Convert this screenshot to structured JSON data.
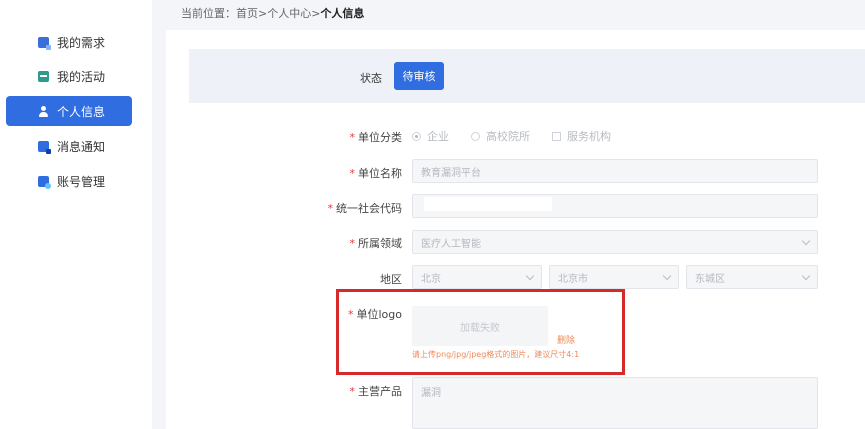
{
  "breadcrumb": {
    "prefix": "当前位置：首页>个人中心>",
    "current": "个人信息"
  },
  "sidebar": {
    "items": [
      {
        "label": "我的需求",
        "icon": "document-icon",
        "active": false
      },
      {
        "label": "我的活动",
        "icon": "calendar-icon",
        "active": false
      },
      {
        "label": "个人信息",
        "icon": "user-icon",
        "active": true
      },
      {
        "label": "消息通知",
        "icon": "message-icon",
        "active": false
      },
      {
        "label": "账号管理",
        "icon": "account-icon",
        "active": false
      }
    ]
  },
  "status": {
    "label": "状态",
    "value": "待审核"
  },
  "form": {
    "unit_type": {
      "label": "单位分类",
      "options": [
        "企业",
        "高校院所",
        "服务机构"
      ],
      "selected": "企业"
    },
    "unit_name": {
      "label": "单位名称",
      "value": "教育漏洞平台"
    },
    "credit_code": {
      "label": "统一社会代码",
      "value": ""
    },
    "domain": {
      "label": "所属领域",
      "value": "医疗人工智能"
    },
    "region": {
      "label": "地区",
      "province": "北京",
      "city": "北京市",
      "district": "东城区"
    },
    "logo": {
      "label": "单位logo",
      "upload_text": "加载失败",
      "delete_text": "删除",
      "hint": "请上传png/jpg/jpeg格式的图片，建议尺寸4:1"
    },
    "products": {
      "label": "主营产品",
      "value": "漏洞"
    }
  },
  "colors": {
    "primary": "#2f6de1",
    "required": "#e0393e",
    "warning": "#ee8a5b",
    "highlight": "#d62a2a"
  }
}
